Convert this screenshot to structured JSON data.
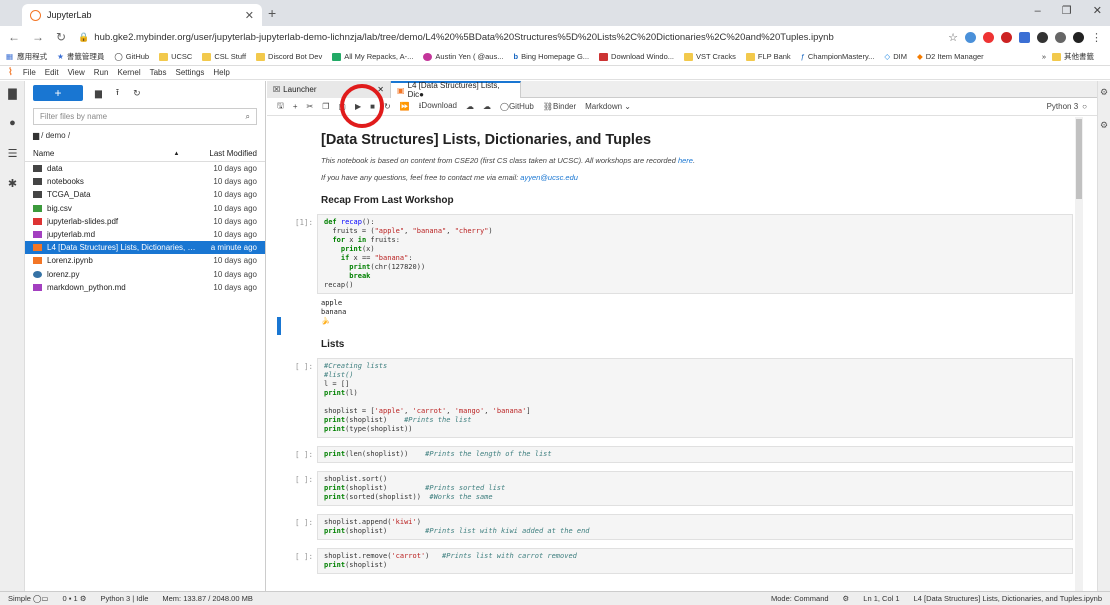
{
  "browser": {
    "tab_title": "JupyterLab",
    "url": "hub.gke2.mybinder.org/user/jupyterlab-jupyterlab-demo-lichnzja/lab/tree/demo/L4%20%5BData%20Structures%5D%20Lists%2C%20Dictionaries%2C%20and%20Tuples.ipynb",
    "bookmarks": [
      "應用程式",
      "書籤管理員",
      "GitHub",
      "UCSC",
      "CSL Stuff",
      "Discord Bot Dev",
      "All My Repacks, A-...",
      "Austin Yen ( @aus...",
      "Bing Homepage G...",
      "Download Windo...",
      "VST Cracks",
      "FLP Bank",
      "ChampionMastery...",
      "DIM",
      "D2 Item Manager"
    ],
    "bookmarks_more": "其他書籤"
  },
  "menubar": [
    "File",
    "Edit",
    "View",
    "Run",
    "Kernel",
    "Tabs",
    "Settings",
    "Help"
  ],
  "filebrowser": {
    "filter_placeholder": "Filter files by name",
    "breadcrumb": "/ demo /",
    "col_name": "Name",
    "col_modified": "Last Modified",
    "files": [
      {
        "name": "data",
        "modified": "10 days ago",
        "icon": "folder-icon"
      },
      {
        "name": "notebooks",
        "modified": "10 days ago",
        "icon": "folder-icon"
      },
      {
        "name": "TCGA_Data",
        "modified": "10 days ago",
        "icon": "folder-icon"
      },
      {
        "name": "big.csv",
        "modified": "10 days ago",
        "icon": "csv-icon"
      },
      {
        "name": "jupyterlab-slides.pdf",
        "modified": "10 days ago",
        "icon": "pdf-icon"
      },
      {
        "name": "jupyterlab.md",
        "modified": "10 days ago",
        "icon": "markdown-icon"
      },
      {
        "name": "L4 [Data Structures] Lists, Dictionaries, a...",
        "modified": "a minute ago",
        "icon": "notebook-icon"
      },
      {
        "name": "Lorenz.ipynb",
        "modified": "10 days ago",
        "icon": "notebook-icon"
      },
      {
        "name": "lorenz.py",
        "modified": "10 days ago",
        "icon": "python-icon"
      },
      {
        "name": "markdown_python.md",
        "modified": "10 days ago",
        "icon": "markdown-icon"
      }
    ]
  },
  "notebook": {
    "tab_launcher": "Launcher",
    "tab_active": "L4 [Data Structures] Lists, Dic●",
    "toolbar": {
      "download": "Download",
      "github": "GitHub",
      "binder": "Binder",
      "celltype": "Markdown",
      "kernel": "Python 3"
    },
    "title": "[Data Structures] Lists, Dictionaries, and Tuples",
    "intro1_pre": "This notebook is based on content from CSE20 (first CS class taken at UCSC). All workshops are recorded ",
    "intro1_link": "here",
    "intro2_pre": "If you have any questions, feel free to contact me via email: ",
    "intro2_link": "ayyen@ucsc.edu",
    "heading_recap": "Recap From Last Workshop",
    "prompt_1": "[1]:",
    "output_1": "apple\nbanana\n🍌",
    "heading_lists": "Lists",
    "prompt_empty": "[ ]:"
  },
  "status": {
    "mode_simple": "Simple",
    "terminals": "0",
    "kernels": "1",
    "kernel_state": "Python 3 | Idle",
    "mem": "Mem: 133.87 / 2048.00 MB",
    "mode": "Mode: Command",
    "cursor": "Ln 1, Col 1",
    "file": "L4 [Data Structures] Lists, Dictionaries, and Tuples.ipynb"
  }
}
